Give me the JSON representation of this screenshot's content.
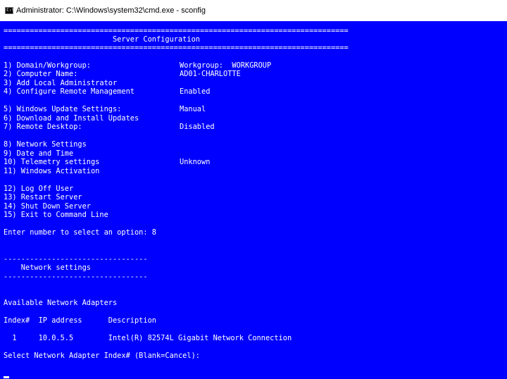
{
  "window": {
    "icon": "cmd-icon",
    "icon_label": "C:\\",
    "title": "Administrator: C:\\Windows\\system32\\cmd.exe - sconfig"
  },
  "colors": {
    "console_background": "#0000ff",
    "console_text": "#ffffff",
    "titlebar_background": "#ffffff"
  },
  "console": {
    "header_rule_top": "===============================================================================",
    "header_title": "                         Server Configuration",
    "header_rule_bottom": "===============================================================================",
    "menu": [
      {
        "label": "1) Domain/Workgroup:",
        "value": "Workgroup:  WORKGROUP"
      },
      {
        "label": "2) Computer Name:",
        "value": "AD01-CHARLOTTE"
      },
      {
        "label": "3) Add Local Administrator",
        "value": ""
      },
      {
        "label": "4) Configure Remote Management",
        "value": "Enabled"
      },
      {
        "label": "5) Windows Update Settings:",
        "value": "Manual"
      },
      {
        "label": "6) Download and Install Updates",
        "value": ""
      },
      {
        "label": "7) Remote Desktop:",
        "value": "Disabled"
      },
      {
        "label": "8) Network Settings",
        "value": ""
      },
      {
        "label": "9) Date and Time",
        "value": ""
      },
      {
        "label": "10) Telemetry settings",
        "value": "Unknown"
      },
      {
        "label": "11) Windows Activation",
        "value": ""
      },
      {
        "label": "12) Log Off User",
        "value": ""
      },
      {
        "label": "13) Restart Server",
        "value": ""
      },
      {
        "label": "14) Shut Down Server",
        "value": ""
      },
      {
        "label": "15) Exit to Command Line",
        "value": ""
      }
    ],
    "prompt_select_option": "Enter number to select an option: 8",
    "network_rule_top": "---------------------------------",
    "network_title": "    Network settings",
    "network_rule_bottom": "---------------------------------",
    "available_adapters": "Available Network Adapters",
    "adapter_header": "Index#  IP address      Description",
    "adapters": [
      {
        "row": "  1     10.0.5.5        Intel(R) 82574L Gigabit Network Connection"
      }
    ],
    "prompt_select_adapter": "Select Network Adapter Index# (Blank=Cancel):"
  }
}
